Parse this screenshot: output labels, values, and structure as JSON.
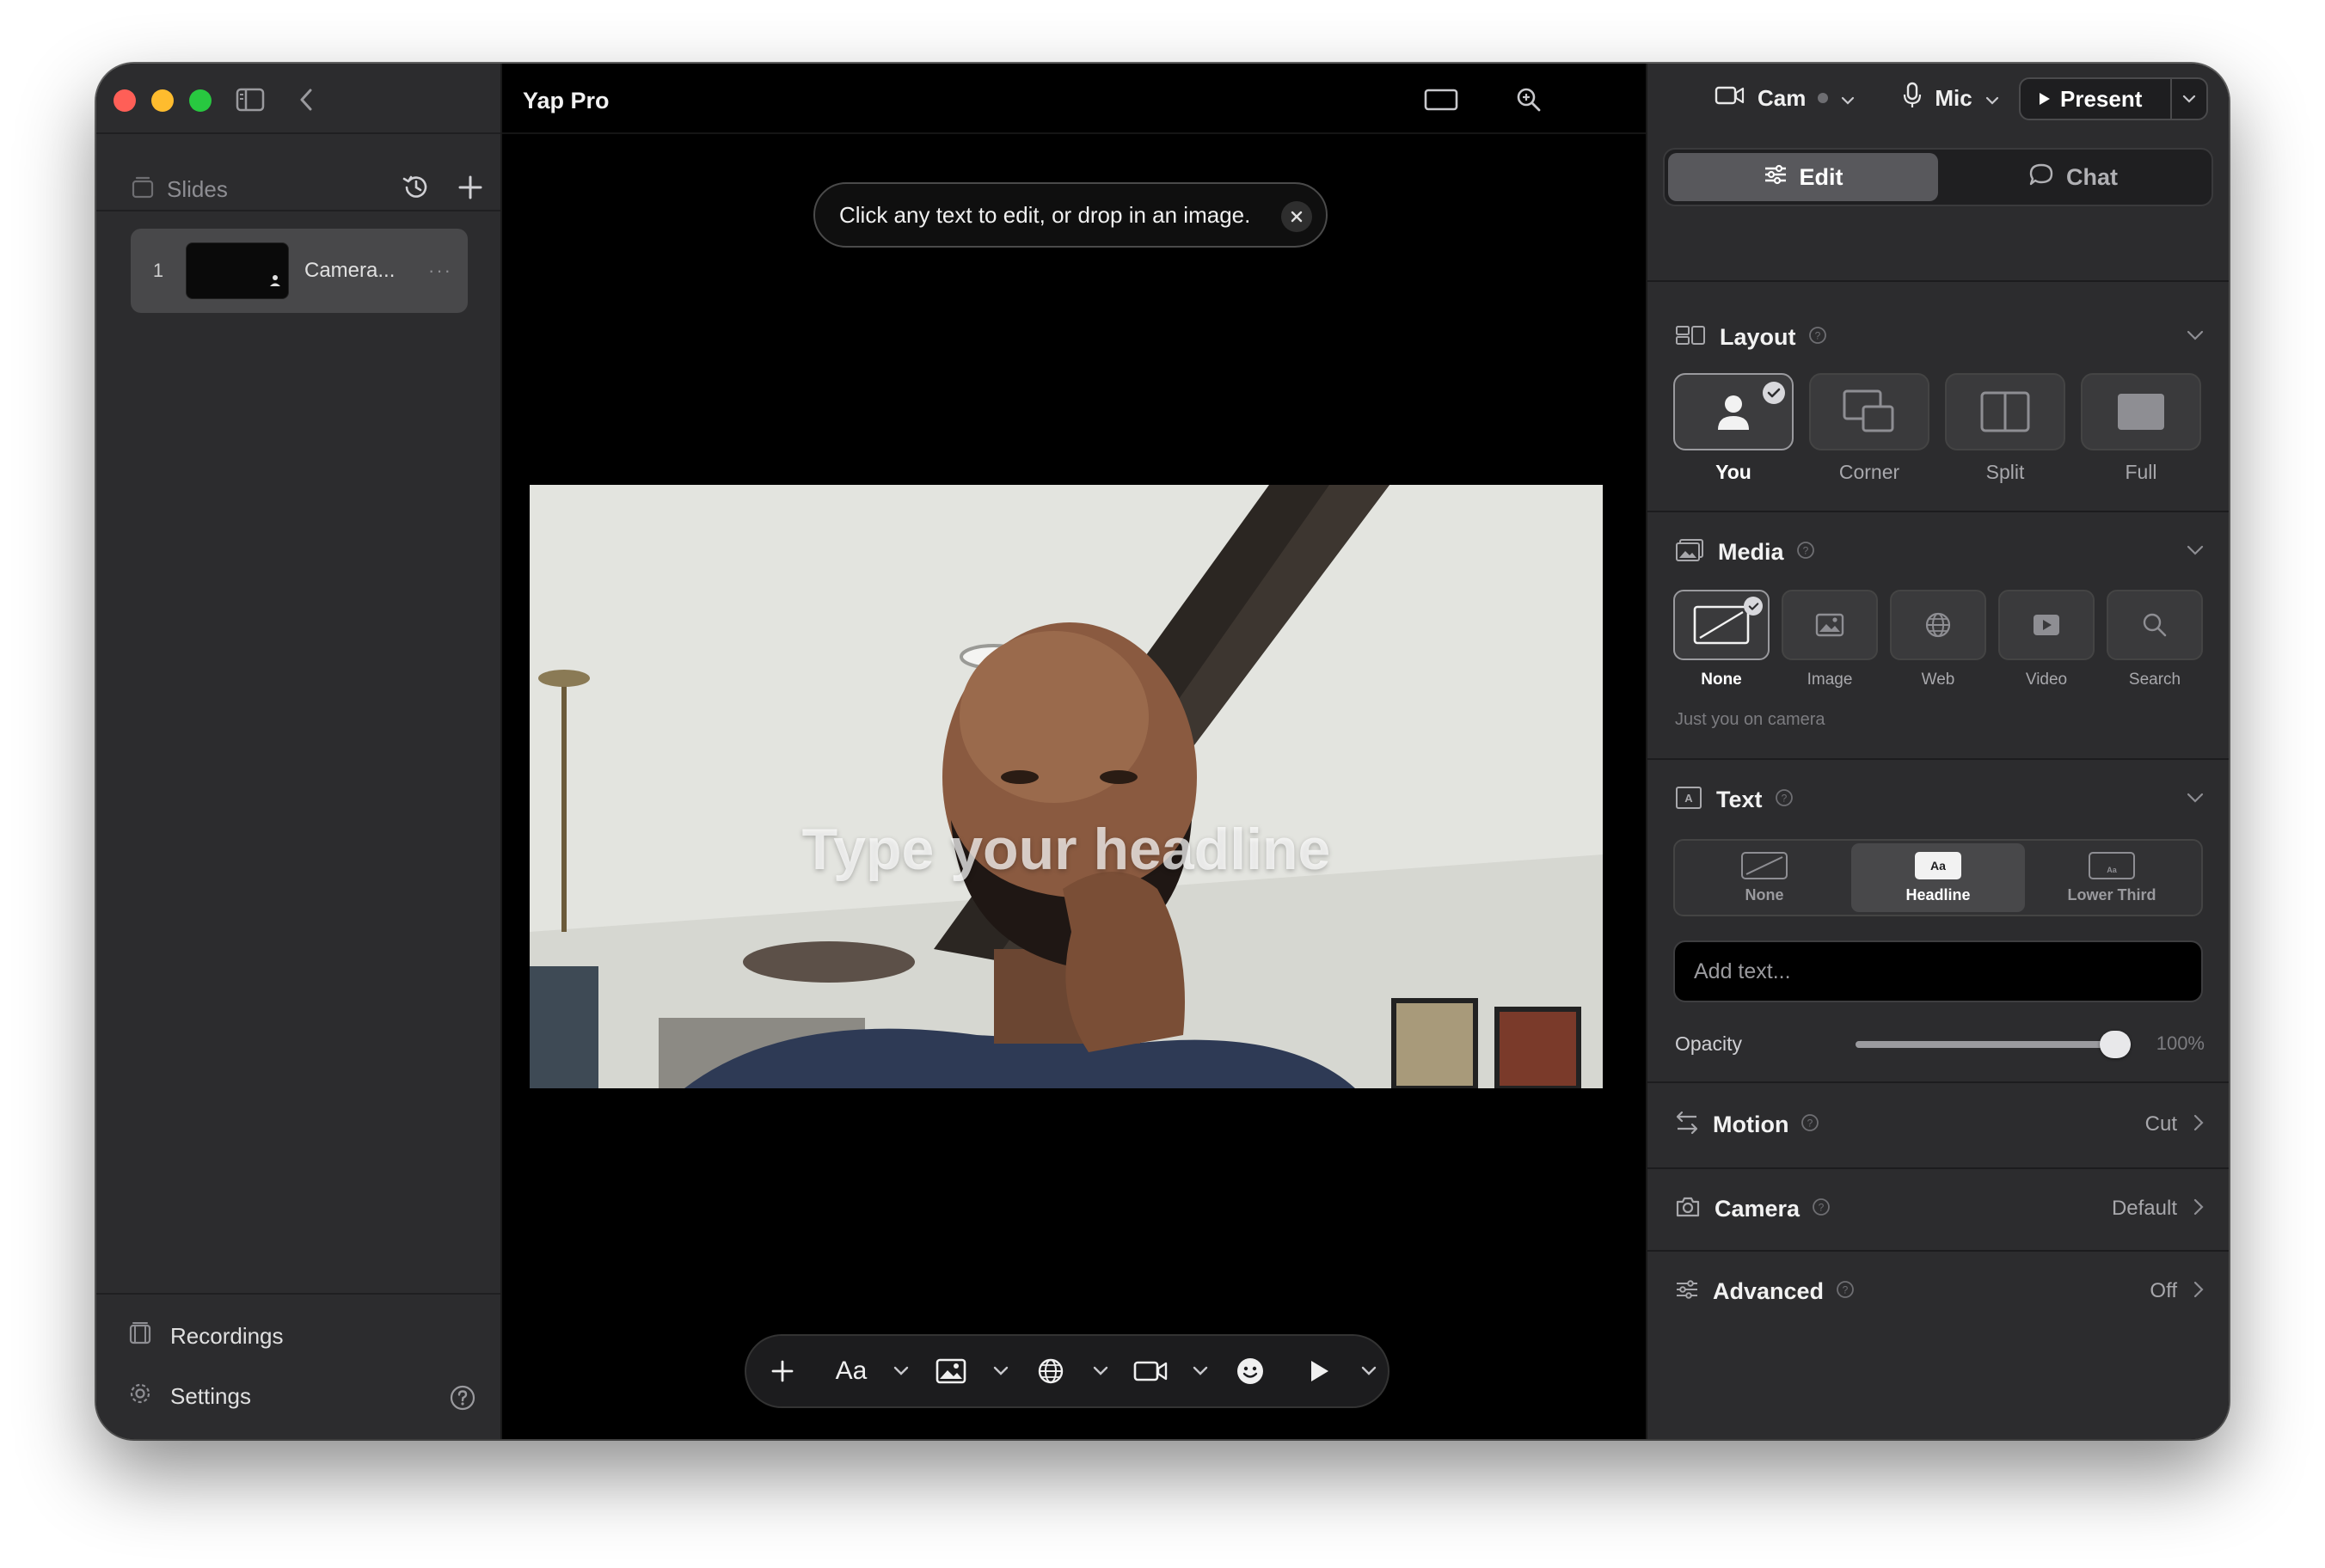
{
  "window": {
    "app_title": "Yap Pro"
  },
  "sidebar": {
    "slides_label": "Slides",
    "slides": [
      {
        "number": "1",
        "name": "Camera...",
        "more": "···"
      }
    ],
    "recordings_label": "Recordings",
    "settings_label": "Settings"
  },
  "canvas": {
    "tip_text": "Click any text to edit, or drop in an image.",
    "headline_placeholder": "Type your headline"
  },
  "toolbar": {
    "text_label": "Aa"
  },
  "top_controls": {
    "cam_label": "Cam",
    "mic_label": "Mic",
    "present_label": "Present"
  },
  "panel": {
    "tabs": [
      {
        "label": "Edit",
        "active": true
      },
      {
        "label": "Chat",
        "active": false
      }
    ],
    "layout": {
      "title": "Layout",
      "options": [
        {
          "label": "You",
          "selected": true
        },
        {
          "label": "Corner",
          "selected": false
        },
        {
          "label": "Split",
          "selected": false
        },
        {
          "label": "Full",
          "selected": false
        }
      ]
    },
    "media": {
      "title": "Media",
      "options": [
        {
          "label": "None",
          "selected": true
        },
        {
          "label": "Image",
          "selected": false
        },
        {
          "label": "Web",
          "selected": false
        },
        {
          "label": "Video",
          "selected": false
        },
        {
          "label": "Search",
          "selected": false
        }
      ],
      "caption": "Just you on camera"
    },
    "text": {
      "title": "Text",
      "options": [
        {
          "label": "None",
          "icon_text": "",
          "selected": false
        },
        {
          "label": "Headline",
          "icon_text": "Aa",
          "selected": true
        },
        {
          "label": "Lower Third",
          "icon_text": "Aa",
          "selected": false
        }
      ],
      "input_placeholder": "Add text...",
      "opacity_label": "Opacity",
      "opacity_value": "100%",
      "opacity_fraction": 1.0
    },
    "motion": {
      "title": "Motion",
      "value": "Cut"
    },
    "camera": {
      "title": "Camera",
      "value": "Default"
    },
    "advanced": {
      "title": "Advanced",
      "value": "Off"
    }
  },
  "colors": {
    "traffic_red": "#ff5f57",
    "traffic_yellow": "#febc2e",
    "traffic_green": "#28c840",
    "panel_bg": "#2c2c2e",
    "canvas_bg": "#000000"
  }
}
